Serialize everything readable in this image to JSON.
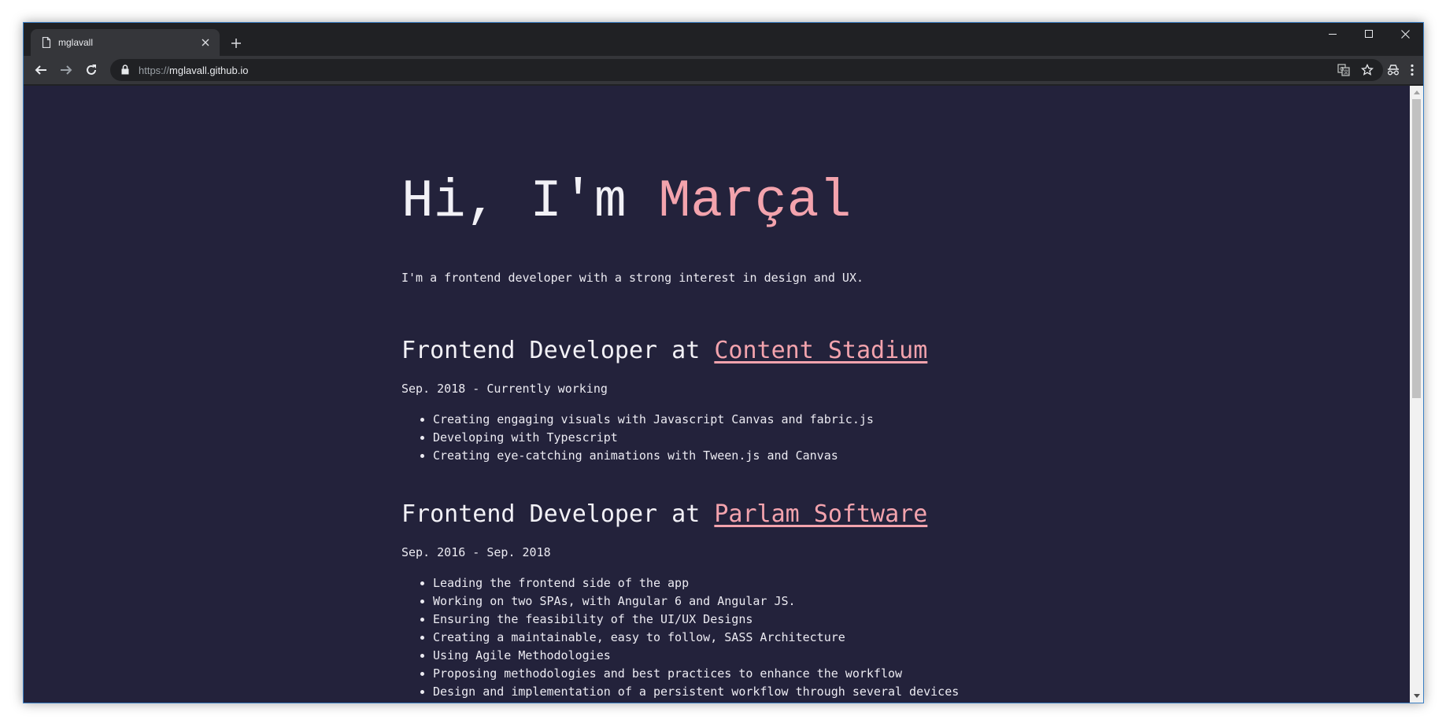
{
  "browser": {
    "tab_title": "mglavall",
    "url_scheme": "https://",
    "url_host": "mglavall.github.io"
  },
  "page": {
    "greeting": "Hi, I'm ",
    "name": "Marçal",
    "intro": "I'm a frontend developer with a strong interest in design and UX.",
    "jobs": [
      {
        "role": "Frontend Developer at ",
        "company": "Content Stadium",
        "dates": "Sep. 2018 - Currently working",
        "items": [
          "Creating engaging visuals with Javascript Canvas and fabric.js",
          "Developing with Typescript",
          "Creating eye-catching animations with Tween.js and Canvas"
        ]
      },
      {
        "role": "Frontend Developer at ",
        "company": "Parlam Software",
        "dates": "Sep. 2016 - Sep. 2018",
        "items": [
          "Leading the frontend side of the app",
          "Working on two SPAs, with Angular 6 and Angular JS.",
          "Ensuring the feasibility of the UI/UX Designs",
          "Creating a maintainable, easy to follow, SASS Architecture",
          "Using Agile Methodologies",
          "Proposing methodologies and best practices to enhance the workflow",
          "Design and implementation of a persistent workflow through several devices"
        ]
      }
    ]
  },
  "colors": {
    "page_background": "#23223b",
    "accent": "#f3a3ad",
    "text": "#ecebf2",
    "browser_frame": "#202124",
    "toolbar": "#35363a"
  },
  "icons": {
    "tab_favicon": "document-icon",
    "tab_close": "close-icon",
    "new_tab": "plus-icon",
    "back": "arrow-left-icon",
    "forward": "arrow-right-icon",
    "reload": "reload-icon",
    "secure": "lock-icon",
    "translate": "translate-icon",
    "bookmark": "star-icon",
    "incognito": "incognito-icon",
    "menu": "kebab-menu-icon"
  }
}
